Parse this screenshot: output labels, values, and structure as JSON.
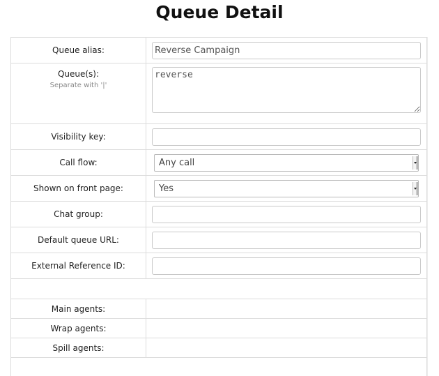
{
  "page": {
    "title": "Queue Detail"
  },
  "form": {
    "queue_alias": {
      "label": "Queue alias:",
      "value": "Reverse Campaign"
    },
    "queues": {
      "label": "Queue(s):",
      "hint": "Separate with '|'",
      "value": "reverse"
    },
    "visibility_key": {
      "label": "Visibility key:",
      "value": ""
    },
    "call_flow": {
      "label": "Call flow:",
      "selected": "Any call"
    },
    "shown_on_front_page": {
      "label": "Shown on front page:",
      "selected": "Yes"
    },
    "chat_group": {
      "label": "Chat group:",
      "value": ""
    },
    "default_queue_url": {
      "label": "Default queue URL:",
      "value": ""
    },
    "external_reference_id": {
      "label": "External Reference ID:",
      "value": ""
    }
  },
  "agents": {
    "main_label": "Main agents:",
    "wrap_label": "Wrap agents:",
    "spill_label": "Spill agents:"
  },
  "colors": {
    "border": "#dcdcdc",
    "input_border": "#c8c8c8",
    "hint_text": "#888888"
  }
}
